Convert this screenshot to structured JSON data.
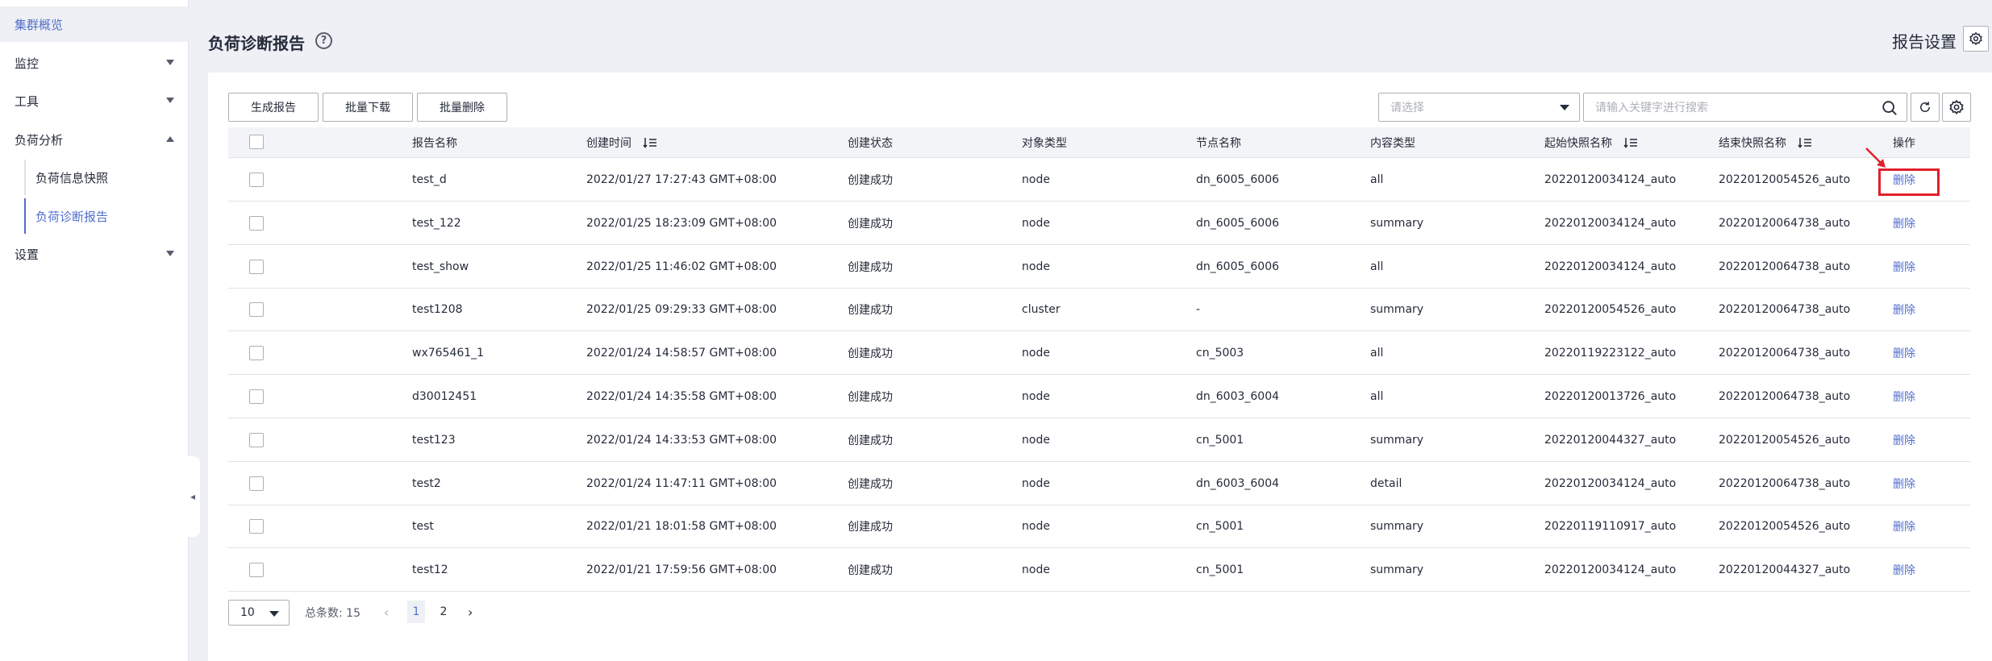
{
  "sidebar": {
    "items": [
      {
        "label": "集群概览"
      },
      {
        "label": "监控"
      },
      {
        "label": "工具"
      },
      {
        "label": "负荷分析"
      },
      {
        "label": "设置"
      }
    ],
    "sub_items": [
      {
        "label": "负荷信息快照"
      },
      {
        "label": "负荷诊断报告"
      }
    ],
    "collapse_glyph": "◂"
  },
  "header": {
    "title": "负荷诊断报告",
    "help_glyph": "?",
    "report_settings_label": "报告设置"
  },
  "toolbar": {
    "generate_label": "生成报告",
    "batch_download_label": "批量下载",
    "batch_delete_label": "批量删除",
    "select_placeholder": "请选择",
    "search_placeholder": "请输入关键字进行搜索"
  },
  "table": {
    "headers": {
      "report_name": "报告名称",
      "create_time": "创建时间",
      "create_status": "创建状态",
      "object_type": "对象类型",
      "node_name": "节点名称",
      "content_type": "内容类型",
      "start_snapshot": "起始快照名称",
      "end_snapshot": "结束快照名称",
      "action": "操作"
    },
    "rows": [
      {
        "name": "test_d",
        "time": "2022/01/27 17:27:43 GMT+08:00",
        "status": "创建成功",
        "object": "node",
        "node": "dn_6005_6006",
        "content": "all",
        "start": "20220120034124_auto",
        "end": "20220120054526_auto",
        "action": "删除"
      },
      {
        "name": "test_122",
        "time": "2022/01/25 18:23:09 GMT+08:00",
        "status": "创建成功",
        "object": "node",
        "node": "dn_6005_6006",
        "content": "summary",
        "start": "20220120034124_auto",
        "end": "20220120064738_auto",
        "action": "删除"
      },
      {
        "name": "test_show",
        "time": "2022/01/25 11:46:02 GMT+08:00",
        "status": "创建成功",
        "object": "node",
        "node": "dn_6005_6006",
        "content": "all",
        "start": "20220120034124_auto",
        "end": "20220120064738_auto",
        "action": "删除"
      },
      {
        "name": "test1208",
        "time": "2022/01/25 09:29:33 GMT+08:00",
        "status": "创建成功",
        "object": "cluster",
        "node": "-",
        "content": "summary",
        "start": "20220120054526_auto",
        "end": "20220120064738_auto",
        "action": "删除"
      },
      {
        "name": "wx765461_1",
        "time": "2022/01/24 14:58:57 GMT+08:00",
        "status": "创建成功",
        "object": "node",
        "node": "cn_5003",
        "content": "all",
        "start": "20220119223122_auto",
        "end": "20220120064738_auto",
        "action": "删除"
      },
      {
        "name": "d30012451",
        "time": "2022/01/24 14:35:58 GMT+08:00",
        "status": "创建成功",
        "object": "node",
        "node": "dn_6003_6004",
        "content": "all",
        "start": "20220120013726_auto",
        "end": "20220120064738_auto",
        "action": "删除"
      },
      {
        "name": "test123",
        "time": "2022/01/24 14:33:53 GMT+08:00",
        "status": "创建成功",
        "object": "node",
        "node": "cn_5001",
        "content": "summary",
        "start": "20220120044327_auto",
        "end": "20220120054526_auto",
        "action": "删除"
      },
      {
        "name": "test2",
        "time": "2022/01/24 11:47:11 GMT+08:00",
        "status": "创建成功",
        "object": "node",
        "node": "dn_6003_6004",
        "content": "detail",
        "start": "20220120034124_auto",
        "end": "20220120064738_auto",
        "action": "删除"
      },
      {
        "name": "test",
        "time": "2022/01/21 18:01:58 GMT+08:00",
        "status": "创建成功",
        "object": "node",
        "node": "cn_5001",
        "content": "summary",
        "start": "20220119110917_auto",
        "end": "20220120054526_auto",
        "action": "删除"
      },
      {
        "name": "test12",
        "time": "2022/01/21 17:59:56 GMT+08:00",
        "status": "创建成功",
        "object": "node",
        "node": "cn_5001",
        "content": "summary",
        "start": "20220120034124_auto",
        "end": "20220120044327_auto",
        "action": "删除"
      }
    ]
  },
  "pagination": {
    "page_size": "10",
    "total_label": "总条数: 15",
    "prev_glyph": "‹",
    "next_glyph": "›",
    "pages": [
      "1",
      "2"
    ],
    "current_page": "1"
  },
  "colors": {
    "accent": "#526ecc",
    "highlight": "#e0202b"
  }
}
